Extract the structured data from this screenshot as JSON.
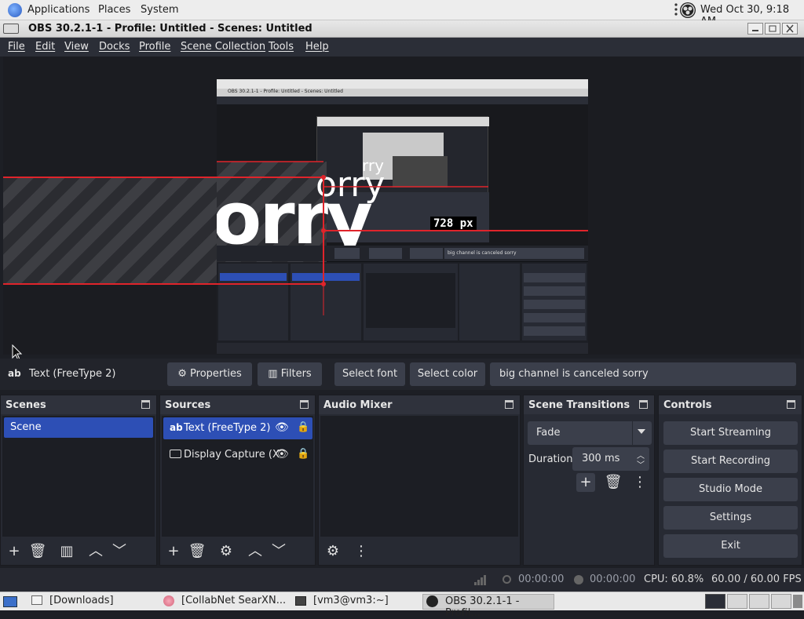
{
  "topbar": {
    "applications": "Applications",
    "places": "Places",
    "system": "System",
    "clock": "Wed Oct 30,  9:18 AM"
  },
  "window": {
    "title": "OBS 30.2.1-1 - Profile: Untitled - Scenes: Untitled"
  },
  "menu": [
    "File",
    "Edit",
    "View",
    "Docks",
    "Profile",
    "Scene Collection",
    "Tools",
    "Help"
  ],
  "preview": {
    "overlay_text": "orry",
    "nested_overlay_text": "orry",
    "size_label": "728 px",
    "nested_title": "OBS 30.2.1-1 - Profile: Untitled - Scenes: Untitled",
    "nested_text_value": "big channel is canceled sorry"
  },
  "source_toolbar": {
    "source_name": "Text (FreeType 2)",
    "properties": "Properties",
    "filters": "Filters",
    "select_font": "Select font",
    "select_color": "Select color",
    "text_value": "big channel is canceled sorry"
  },
  "scenes": {
    "title": "Scenes",
    "items": [
      "Scene"
    ]
  },
  "sources": {
    "title": "Sources",
    "items": [
      {
        "name": "Text (FreeType 2)",
        "selected": true
      },
      {
        "name": "Display Capture (X",
        "selected": false
      }
    ]
  },
  "audio_mixer": {
    "title": "Audio Mixer"
  },
  "transitions": {
    "title": "Scene Transitions",
    "selected": "Fade",
    "duration_label": "Duration",
    "duration_value": "300 ms"
  },
  "controls": {
    "title": "Controls",
    "buttons": [
      "Start Streaming",
      "Start Recording",
      "Studio Mode",
      "Settings",
      "Exit"
    ]
  },
  "status": {
    "stream_time": "00:00:00",
    "record_time": "00:00:00",
    "cpu": "CPU: 60.8%",
    "fps": "60.00 / 60.00 FPS"
  },
  "taskbar": {
    "items": [
      "[Downloads]",
      "[CollabNet SearXN...",
      "[vm3@vm3:~]",
      "OBS 30.2.1-1 - Profil..."
    ]
  },
  "colors": {
    "accent": "#2d4fb5",
    "guide_red": "#e0242b",
    "panel": "#272a33"
  }
}
